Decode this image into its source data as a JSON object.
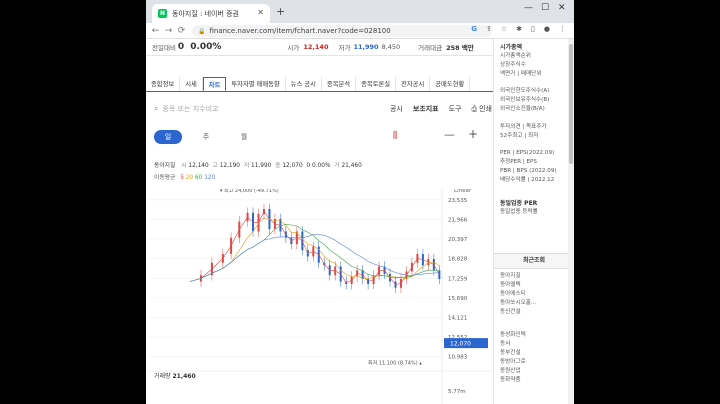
{
  "browser": {
    "tab_title": "동아지질 : 네이버 증권",
    "tab_icon": "N",
    "url": "finance.naver.com/item/fchart.naver?code=028100",
    "new_tab_label": "+"
  },
  "stock_line": {
    "change_label": "전일대비",
    "change_value": "0",
    "change_pct": "0.00%",
    "high_label": "시가",
    "high_value": "12,140",
    "low_label": "저가",
    "low_value": "11,990",
    "low_sub": "8,450",
    "volume_label": "거래대금",
    "volume_value": "258 백만"
  },
  "tabs": [
    "종합정보",
    "시세",
    "차트",
    "투자자별 매매동향",
    "뉴스 공시",
    "종목분석",
    "종목토론실",
    "전자공시",
    "공매도현황"
  ],
  "active_tab": 2,
  "search": {
    "placeholder": "종목 또는 지수비교",
    "tools": [
      "공시",
      "보조지표",
      "도구",
      "인쇄"
    ]
  },
  "periods": [
    "일",
    "주",
    "월"
  ],
  "active_period": 0,
  "quote": {
    "name": "동아지질",
    "s_label": "시",
    "s_val": "12,140",
    "g_val": "12,190",
    "j_label": "저",
    "j_val": "11,990",
    "e_val": "12,070",
    "chg": "0 0.00%",
    "v_label": "거",
    "v_val": "21,460"
  },
  "ma": {
    "label": "이동평균",
    "periods": [
      "5",
      "20",
      "60",
      "120"
    ],
    "colors": [
      "#e04848",
      "#e0a020",
      "#3aa64a",
      "#5a7fe0"
    ]
  },
  "chart_data": {
    "type": "candlestick",
    "scale_label": "Linear",
    "y_ticks": [
      23535,
      21966,
      20397,
      18828,
      17259,
      15690,
      14121,
      12552,
      10983
    ],
    "ylim": [
      10400,
      24400
    ],
    "current_price": "12,070",
    "max_label": "최고 24,000 (-49.71%)",
    "min_label": "최저 11,100 (8.74%)",
    "volume_label": "거래량",
    "volume_value": "21,460",
    "volume_axis_tick": "5.77m",
    "up_color": "#e04848",
    "down_color": "#2b66cf"
  },
  "side": {
    "items_top": [
      "시가총액",
      "시가총액순위",
      "상장주식수",
      "액면가 | 매매단위"
    ],
    "items_foreign": [
      "외국인한도주식수(A)",
      "외국인보유주식수(B)",
      "외국인소진율(B/A)"
    ],
    "items_opinion": [
      "투자의견 | 목표주가",
      "52주최고 | 최저"
    ],
    "items_per": [
      "PER | EPS(2022.09)",
      "추정PER | EPS",
      "PBR | BPS (2022.09)",
      "배당수익률 | 2022.12"
    ],
    "items_sector": [
      "동일업종 PER",
      "동일업종 등락률"
    ],
    "recent_title": "최근조회",
    "recent": [
      "동아지질",
      "동아엘텍",
      "동아에스티",
      "동아쏘시오홀...",
      "동신건설"
    ],
    "recent2": [
      "동성화인텍",
      "동서",
      "동부건설",
      "동방아그로",
      "동원산업",
      "동화약품"
    ]
  }
}
